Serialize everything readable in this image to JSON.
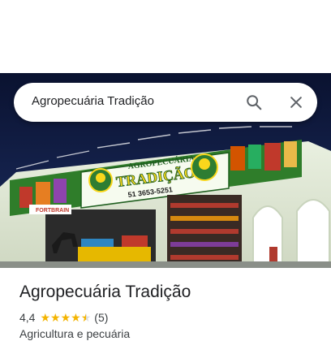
{
  "search": {
    "query": "Agropecuária Tradição"
  },
  "icons": {
    "search": "search-icon",
    "close": "close-icon",
    "star": "star-icon"
  },
  "colors": {
    "star": "#f4b400",
    "sign_green": "#2e7d32",
    "sign_yellow": "#f9d71c"
  },
  "photo": {
    "sign_top": "AGROPECUÁRIA",
    "sign_name": "TRADIÇÃO",
    "sign_phone": "51 3653-5251",
    "logo_text": "TRADIÇÃO",
    "small_sign": "FORTBRAIN"
  },
  "place": {
    "name": "Agropecuária Tradição",
    "rating": "4,4",
    "rating_value": 4.4,
    "rating_max": 5,
    "reviews": "(5)",
    "category": "Agricultura e pecuária"
  }
}
